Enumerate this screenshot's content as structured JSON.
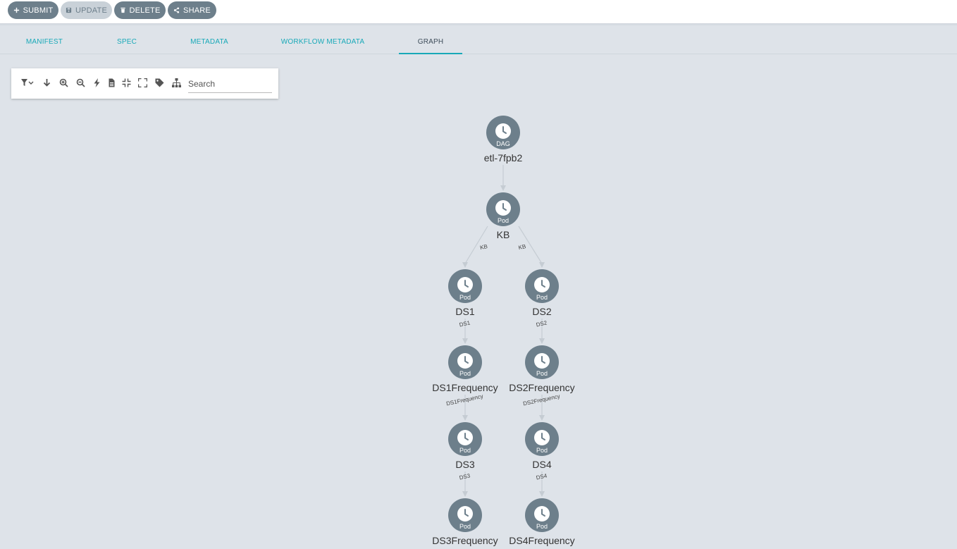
{
  "actions": {
    "submit": "SUBMIT",
    "update": "UPDATE",
    "delete": "DELETE",
    "share": "SHARE"
  },
  "tabs": [
    {
      "label": "MANIFEST",
      "active": false
    },
    {
      "label": "SPEC",
      "active": false
    },
    {
      "label": "METADATA",
      "active": false
    },
    {
      "label": "WORKFLOW METADATA",
      "active": false
    },
    {
      "label": "GRAPH",
      "active": true
    }
  ],
  "toolbar": {
    "icons": [
      "filter-icon",
      "download-icon",
      "zoom-in-icon",
      "zoom-out-icon",
      "bolt-icon",
      "file-icon",
      "compress-icon",
      "expand-icon",
      "tag-icon",
      "hierarchy-icon"
    ],
    "search_placeholder": "Search"
  },
  "graph": {
    "nodes": [
      {
        "id": "etl-7fpb2",
        "label": "etl-7fpb2",
        "type": "DAG"
      },
      {
        "id": "KB",
        "label": "KB",
        "type": "Pod"
      },
      {
        "id": "DS1",
        "label": "DS1",
        "type": "Pod"
      },
      {
        "id": "DS2",
        "label": "DS2",
        "type": "Pod"
      },
      {
        "id": "DS1Frequency",
        "label": "DS1Frequency",
        "type": "Pod"
      },
      {
        "id": "DS2Frequency",
        "label": "DS2Frequency",
        "type": "Pod"
      },
      {
        "id": "DS3",
        "label": "DS3",
        "type": "Pod"
      },
      {
        "id": "DS4",
        "label": "DS4",
        "type": "Pod"
      },
      {
        "id": "DS3Frequency",
        "label": "DS3Frequency",
        "type": "Pod"
      },
      {
        "id": "DS4Frequency",
        "label": "DS4Frequency",
        "type": "Pod"
      }
    ],
    "edges": [
      {
        "from": "etl-7fpb2",
        "to": "KB",
        "label": ""
      },
      {
        "from": "KB",
        "to": "DS1",
        "label": "KB"
      },
      {
        "from": "KB",
        "to": "DS2",
        "label": "KB"
      },
      {
        "from": "DS1",
        "to": "DS1Frequency",
        "label": "DS1"
      },
      {
        "from": "DS2",
        "to": "DS2Frequency",
        "label": "DS2"
      },
      {
        "from": "DS1Frequency",
        "to": "DS3",
        "label": "DS1Frequency"
      },
      {
        "from": "DS2Frequency",
        "to": "DS4",
        "label": "DS2Frequency"
      },
      {
        "from": "DS3",
        "to": "DS3Frequency",
        "label": "DS3"
      },
      {
        "from": "DS4",
        "to": "DS4Frequency",
        "label": "DS4"
      }
    ]
  },
  "colors": {
    "accent": "#18a9b8",
    "node": "#6d7f8b",
    "background": "#dee3e9"
  }
}
